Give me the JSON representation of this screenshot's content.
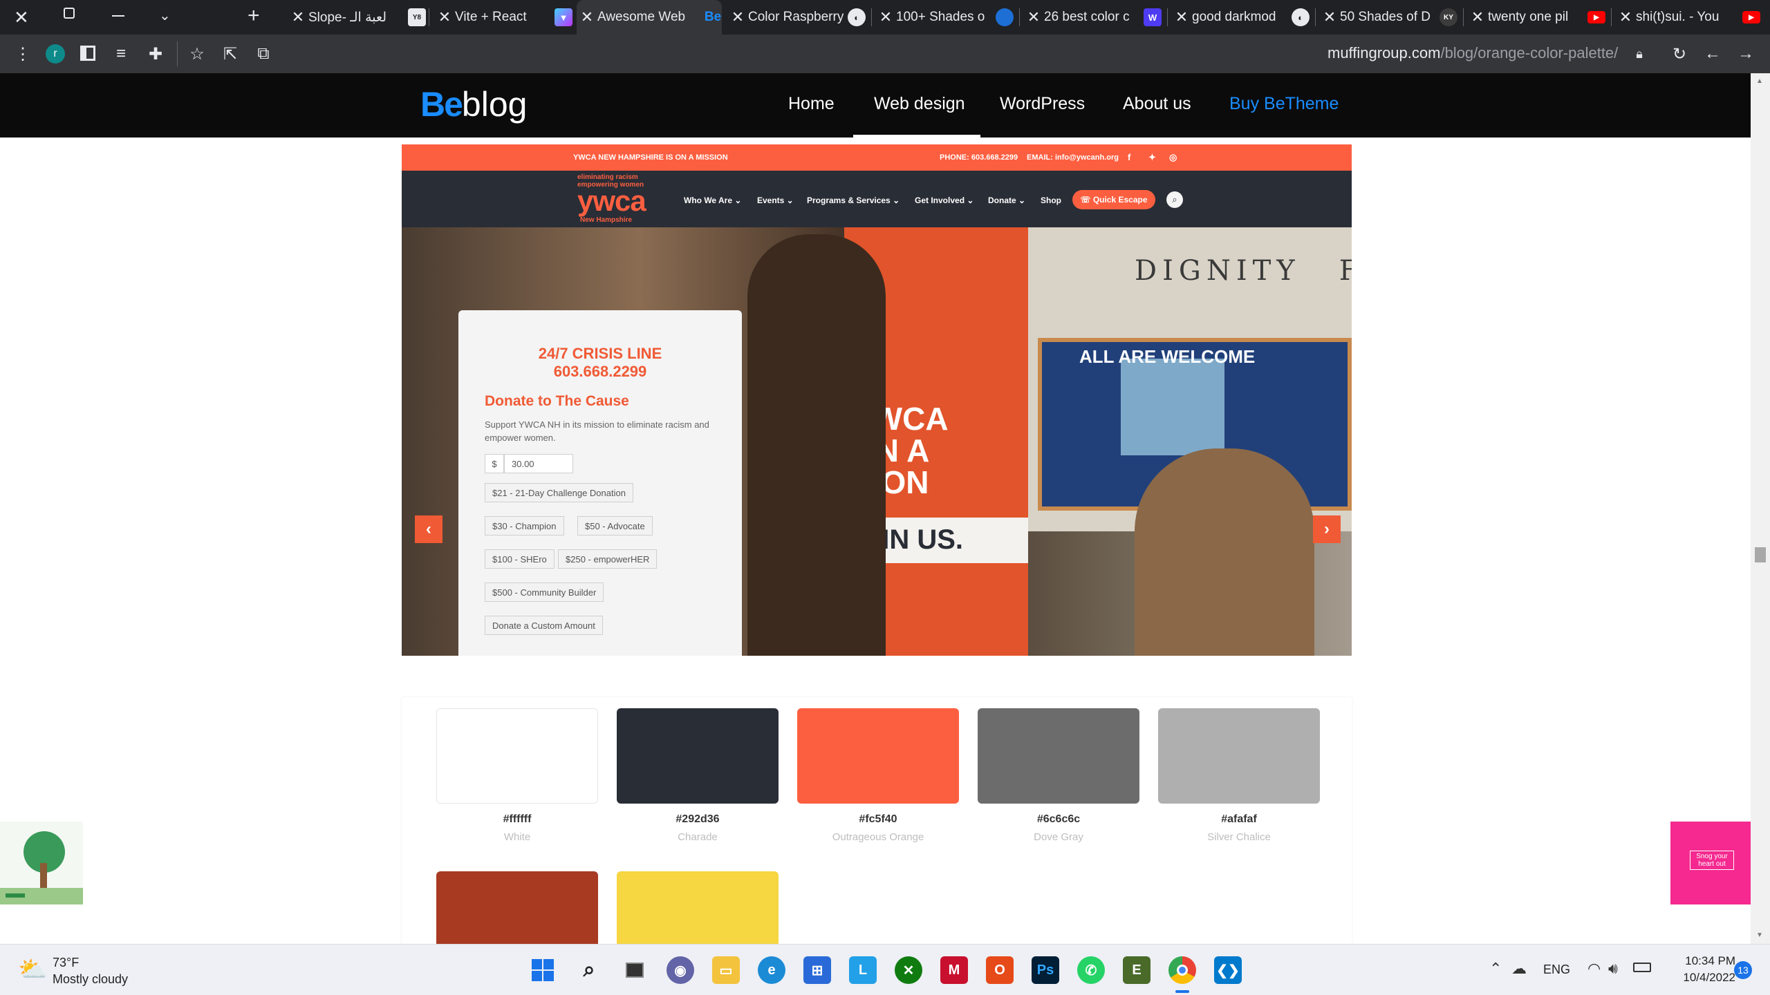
{
  "browser": {
    "tabs": [
      {
        "title": "Slope- لعبة الـ"
      },
      {
        "title": "Vite + React"
      },
      {
        "title": "Awesome Web"
      },
      {
        "title": "Color Raspberry"
      },
      {
        "title": "100+ Shades o"
      },
      {
        "title": "26 best color c"
      },
      {
        "title": "good darkmod"
      },
      {
        "title": "50 Shades of D"
      },
      {
        "title": "twenty one pil"
      },
      {
        "title": "shi(t)sui. - You"
      }
    ],
    "new_tab_symbol": "+",
    "address": {
      "domain": "muffingroup.com",
      "path": "/blog/orange-color-palette/"
    },
    "profile_initial": "r"
  },
  "site": {
    "logo_be": "Be",
    "logo_blog": "blog",
    "nav": [
      "Home",
      "Web design",
      "WordPress",
      "About us",
      "Buy BeTheme"
    ],
    "active_nav": "Web design"
  },
  "ywca": {
    "topbar_mission": "YWCA NEW HAMPSHIRE IS ON A MISSION",
    "topbar_phone": "PHONE: 603.668.2299",
    "topbar_email": "EMAIL: info@ywcanh.org",
    "logo_tagline1": "eliminating racism",
    "logo_tagline2": "empowering women",
    "logo": "ywca",
    "logo_sub": "New Hampshire",
    "nav": [
      "Who We Are ⌄",
      "Events ⌄",
      "Programs & Services ⌄",
      "Get Involved ⌄",
      "Donate ⌄",
      "Shop"
    ],
    "quick_escape": "Quick Escape",
    "crisis_title": "24/7 CRISIS LINE",
    "crisis_phone": "603.668.2299",
    "donate_title": "Donate to The Cause",
    "donate_text": "Support YWCA NH in its mission to eliminate racism and empower women.",
    "currency": "$",
    "amount": "30.00",
    "options": [
      "$21 - 21-Day Challenge Donation",
      "$30 - Champion",
      "$50 - Advocate",
      "$100 - SHEro",
      "$250 - empowerHER",
      "$500 - Community Builder",
      "Donate a Custom Amount"
    ],
    "sign_text": "DIGNITY",
    "sign_text2": "FOR",
    "poster_line1": "YWCA",
    "poster_line2": "ON A",
    "poster_line3": "SION",
    "poster_line4": "JIN US.",
    "board_text": "ALL ARE WELCOME"
  },
  "palette": [
    {
      "hex": "#ffffff",
      "name": "White",
      "color": "#ffffff"
    },
    {
      "hex": "#292d36",
      "name": "Charade",
      "color": "#292d36"
    },
    {
      "hex": "#fc5f40",
      "name": "Outrageous Orange",
      "color": "#fc5f40"
    },
    {
      "hex": "#6c6c6c",
      "name": "Dove Gray",
      "color": "#6c6c6c"
    },
    {
      "hex": "#afafaf",
      "name": "Silver Chalice",
      "color": "#afafaf"
    }
  ],
  "palette_row2_colors": [
    "#a83a22",
    "#f6d641"
  ],
  "side_ad_right": "Snog your heart out",
  "taskbar": {
    "temp": "73°F",
    "weather": "Mostly cloudy",
    "lang": "ENG",
    "time": "10:34 PM",
    "date": "10/4/2022",
    "notifications": "13"
  }
}
